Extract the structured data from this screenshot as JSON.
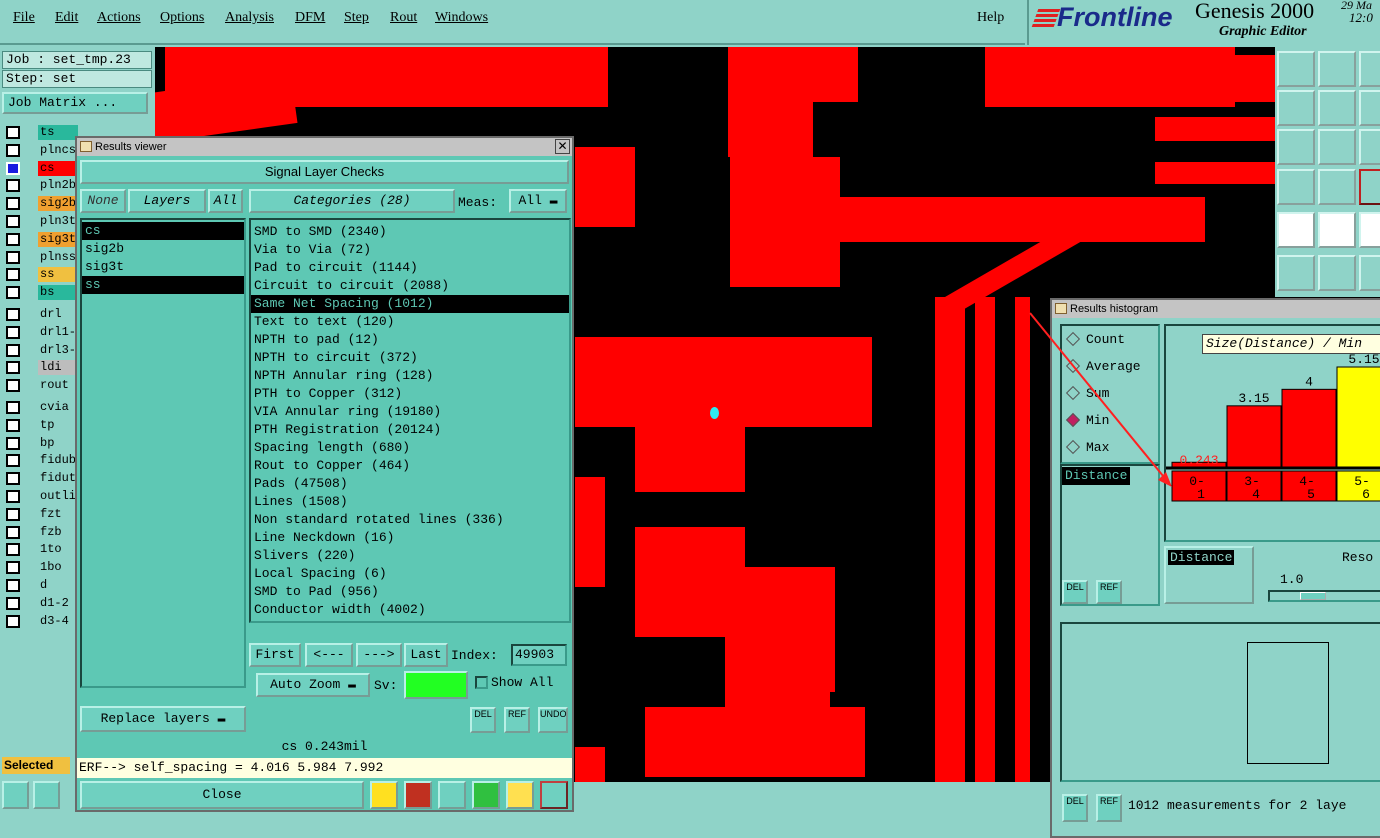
{
  "menu": {
    "items": [
      "File",
      "Edit",
      "Actions",
      "Options",
      "Analysis",
      "DFM",
      "Step",
      "Rout",
      "Windows"
    ],
    "help": "Help"
  },
  "brand": {
    "logo": "Frontline",
    "product": "Genesis 2000",
    "subtitle": "Graphic Editor",
    "date": "29 Ma",
    "time": "12:0"
  },
  "job": {
    "job_label": "Job : set_tmp.23",
    "step_label": "Step: set",
    "matrix_button": "Job Matrix ..."
  },
  "layers": [
    {
      "name": "ts",
      "color": "#29b89c",
      "selected": false
    },
    {
      "name": "plncs",
      "color": "#8fd3c8",
      "selected": false
    },
    {
      "name": "cs",
      "color": "#ff0000",
      "selected": true
    },
    {
      "name": "pln2b",
      "color": "#8fd3c8",
      "selected": false
    },
    {
      "name": "sig2b",
      "color": "#f0a030",
      "selected": false
    },
    {
      "name": "pln3t",
      "color": "#8fd3c8",
      "selected": false
    },
    {
      "name": "sig3t",
      "color": "#f0a030",
      "selected": false
    },
    {
      "name": "plnss",
      "color": "#8fd3c8",
      "selected": false
    },
    {
      "name": "ss",
      "color": "#f0c040",
      "selected": false
    },
    {
      "name": "bs",
      "color": "#29b89c",
      "selected": false
    },
    {
      "name": "drl",
      "color": "#8fd3c8",
      "selected": false
    },
    {
      "name": "drl1-",
      "color": "#8fd3c8",
      "selected": false
    },
    {
      "name": "drl3-",
      "color": "#8fd3c8",
      "selected": false
    },
    {
      "name": "ldi",
      "color": "#bdbdbd",
      "selected": false
    },
    {
      "name": "rout",
      "color": "#8fd3c8",
      "selected": false
    },
    {
      "name": "cvia",
      "color": "#8fd3c8",
      "selected": false
    },
    {
      "name": "tp",
      "color": "#8fd3c8",
      "selected": false
    },
    {
      "name": "bp",
      "color": "#8fd3c8",
      "selected": false
    },
    {
      "name": "fidub",
      "color": "#8fd3c8",
      "selected": false
    },
    {
      "name": "fidut",
      "color": "#8fd3c8",
      "selected": false
    },
    {
      "name": "outli",
      "color": "#8fd3c8",
      "selected": false
    },
    {
      "name": "fzt",
      "color": "#8fd3c8",
      "selected": false
    },
    {
      "name": "fzb",
      "color": "#8fd3c8",
      "selected": false
    },
    {
      "name": "1to",
      "color": "#8fd3c8",
      "selected": false
    },
    {
      "name": "1bo",
      "color": "#8fd3c8",
      "selected": false
    },
    {
      "name": "d",
      "color": "#8fd3c8",
      "selected": false
    },
    {
      "name": "d1-2",
      "color": "#8fd3c8",
      "selected": false
    },
    {
      "name": "d3-4",
      "color": "#8fd3c8",
      "selected": false
    }
  ],
  "status": {
    "selected_label": "Selected"
  },
  "viewer": {
    "title": "Results viewer",
    "header": "Signal Layer Checks",
    "none_btn": "None",
    "layers_btn": "Layers",
    "all_btn": "All",
    "categories_btn": "Categories (28)",
    "meas_label": "Meas:",
    "meas_value": "All",
    "layer_list": [
      {
        "name": "cs",
        "hl": true
      },
      {
        "name": "sig2b",
        "hl": false
      },
      {
        "name": "sig3t",
        "hl": false
      },
      {
        "name": "ss",
        "hl": true
      }
    ],
    "categories": [
      {
        "name": "SMD to SMD (2340)",
        "hl": false
      },
      {
        "name": "Via to Via (72)",
        "hl": false
      },
      {
        "name": "Pad to circuit (1144)",
        "hl": false
      },
      {
        "name": "Circuit to circuit (2088)",
        "hl": false
      },
      {
        "name": "Same Net Spacing (1012)",
        "hl": true
      },
      {
        "name": "Text to text (120)",
        "hl": false
      },
      {
        "name": "NPTH to pad (12)",
        "hl": false
      },
      {
        "name": "NPTH to circuit (372)",
        "hl": false
      },
      {
        "name": "NPTH Annular ring (128)",
        "hl": false
      },
      {
        "name": "PTH to Copper (312)",
        "hl": false
      },
      {
        "name": "VIA Annular ring (19180)",
        "hl": false
      },
      {
        "name": "PTH Registration (20124)",
        "hl": false
      },
      {
        "name": "Spacing length (680)",
        "hl": false
      },
      {
        "name": "Rout to Copper (464)",
        "hl": false
      },
      {
        "name": "Pads (47508)",
        "hl": false
      },
      {
        "name": "Lines (1508)",
        "hl": false
      },
      {
        "name": "Non standard rotated lines (336)",
        "hl": false
      },
      {
        "name": "Line Neckdown (16)",
        "hl": false
      },
      {
        "name": "Slivers (220)",
        "hl": false
      },
      {
        "name": "Local Spacing (6)",
        "hl": false
      },
      {
        "name": "SMD to Pad (956)",
        "hl": false
      },
      {
        "name": "Conductor width (4002)",
        "hl": false
      }
    ],
    "first_btn": "First",
    "prev_btn": "<---",
    "next_btn": "--->",
    "last_btn": "Last",
    "index_label": "Index:",
    "index_value": "49903",
    "zoom_btn": "Auto Zoom",
    "sv_label": "Sv:",
    "show_all_label": "Show All",
    "replace_btn": "Replace layers",
    "del_label": "DEL",
    "ref_label": "REF",
    "undo_label": "UNDO",
    "measure_text": "cs 0.243mil",
    "erf_text": "ERF--> self_spacing = 4.016 5.984 7.992",
    "close_btn": "Close"
  },
  "histogram": {
    "title": "Results histogram",
    "options": [
      {
        "label": "Count",
        "on": false
      },
      {
        "label": "Average",
        "on": false
      },
      {
        "label": "Sum",
        "on": false
      },
      {
        "label": "Min",
        "on": true
      },
      {
        "label": "Max",
        "on": false
      }
    ],
    "list_item": "Distance",
    "chart_title": "Size(Distance) / Min",
    "distance_label": "Distance",
    "reso_label": "Reso",
    "reso_value": "1.0",
    "del_label": "DEL",
    "ref_label": "REF",
    "status": "1012 measurements for 2 laye"
  },
  "chart_data": {
    "type": "bar",
    "title": "Size(Distance) / Min",
    "categories": [
      "0-1",
      "3-4",
      "4-5",
      "5-6"
    ],
    "values": [
      0.243,
      3.15,
      4,
      5.15
    ],
    "value_labels": [
      "0.243",
      "3.15",
      "4",
      "5.15"
    ],
    "colors": [
      "#ff0000",
      "#ff0000",
      "#ff0000",
      "#ffff00"
    ]
  }
}
